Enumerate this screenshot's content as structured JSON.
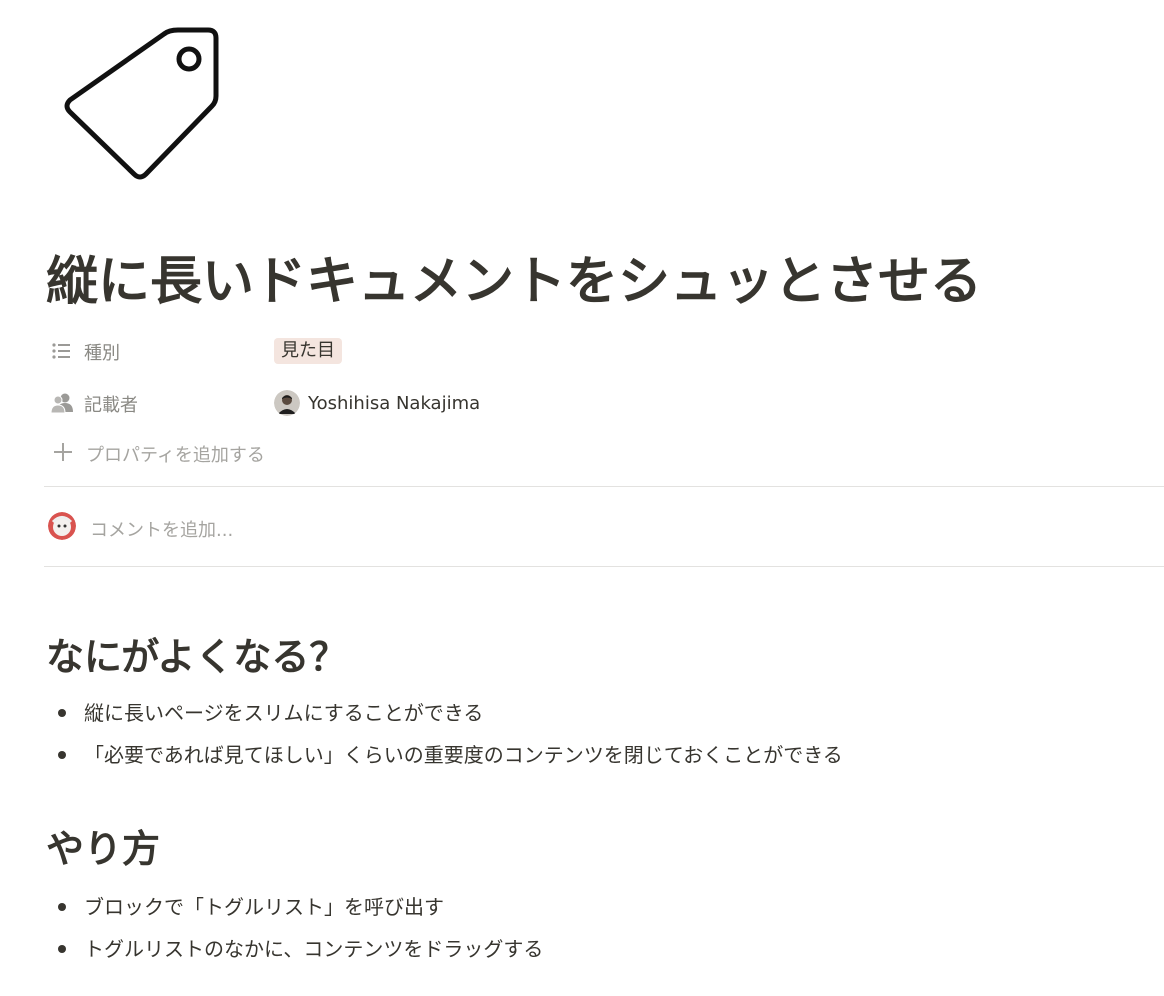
{
  "page": {
    "icon": "price-tag-icon",
    "title": "縦に長いドキュメントをシュッとさせる"
  },
  "properties": [
    {
      "icon": "list-icon",
      "label": "種別",
      "type": "tag",
      "value": "見た目",
      "tag_color": "#f4e5df"
    },
    {
      "icon": "people-icon",
      "label": "記載者",
      "type": "person",
      "value": "Yoshihisa Nakajima"
    }
  ],
  "add_property_label": "プロパティを追加する",
  "comment": {
    "placeholder": "コメントを追加..."
  },
  "sections": [
    {
      "heading": "なにがよくなる？",
      "items": [
        "縦に長いページをスリムにすることができる",
        "「必要であれば見てほしい」くらいの重要度のコンテンツを閉じておくことができる"
      ]
    },
    {
      "heading": "やり方",
      "items": [
        "ブロックで「トグルリスト」を呼び出す",
        "トグルリストのなかに、コンテンツをドラッグする"
      ]
    }
  ]
}
